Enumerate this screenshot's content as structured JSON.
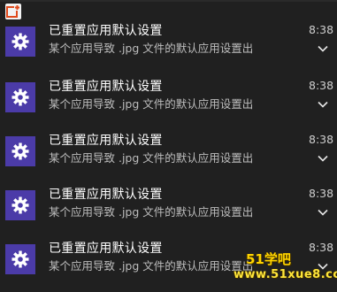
{
  "app_icon": "notification-app-icon",
  "notifications": [
    {
      "title": "已重置应用默认设置",
      "description": "某个应用导致 .jpg 文件的默认应用设置出",
      "time": "8:38",
      "icon": "gear-icon",
      "expand_icon": "chevron-down-icon"
    },
    {
      "title": "已重置应用默认设置",
      "description": "某个应用导致 .jpg 文件的默认应用设置出",
      "time": "8:38",
      "icon": "gear-icon",
      "expand_icon": "chevron-down-icon"
    },
    {
      "title": "已重置应用默认设置",
      "description": "某个应用导致 .jpg 文件的默认应用设置出",
      "time": "8:38",
      "icon": "gear-icon",
      "expand_icon": "chevron-down-icon"
    },
    {
      "title": "已重置应用默认设置",
      "description": "某个应用导致 .jpg 文件的默认应用设置出",
      "time": "8:38",
      "icon": "gear-icon",
      "expand_icon": "chevron-down-icon"
    },
    {
      "title": "已重置应用默认设置",
      "description": "某个应用导致 .jpg 文件的默认应用设置出",
      "time": "8:38",
      "icon": "gear-icon",
      "expand_icon": "chevron-down-icon"
    }
  ],
  "watermark": {
    "line1": "51学吧",
    "line2": "www.51xue8.com"
  },
  "colors": {
    "background": "#202020",
    "tile": "#4b3ba8",
    "app_icon_accent": "#e04a1c",
    "watermark": "#ffd400"
  }
}
